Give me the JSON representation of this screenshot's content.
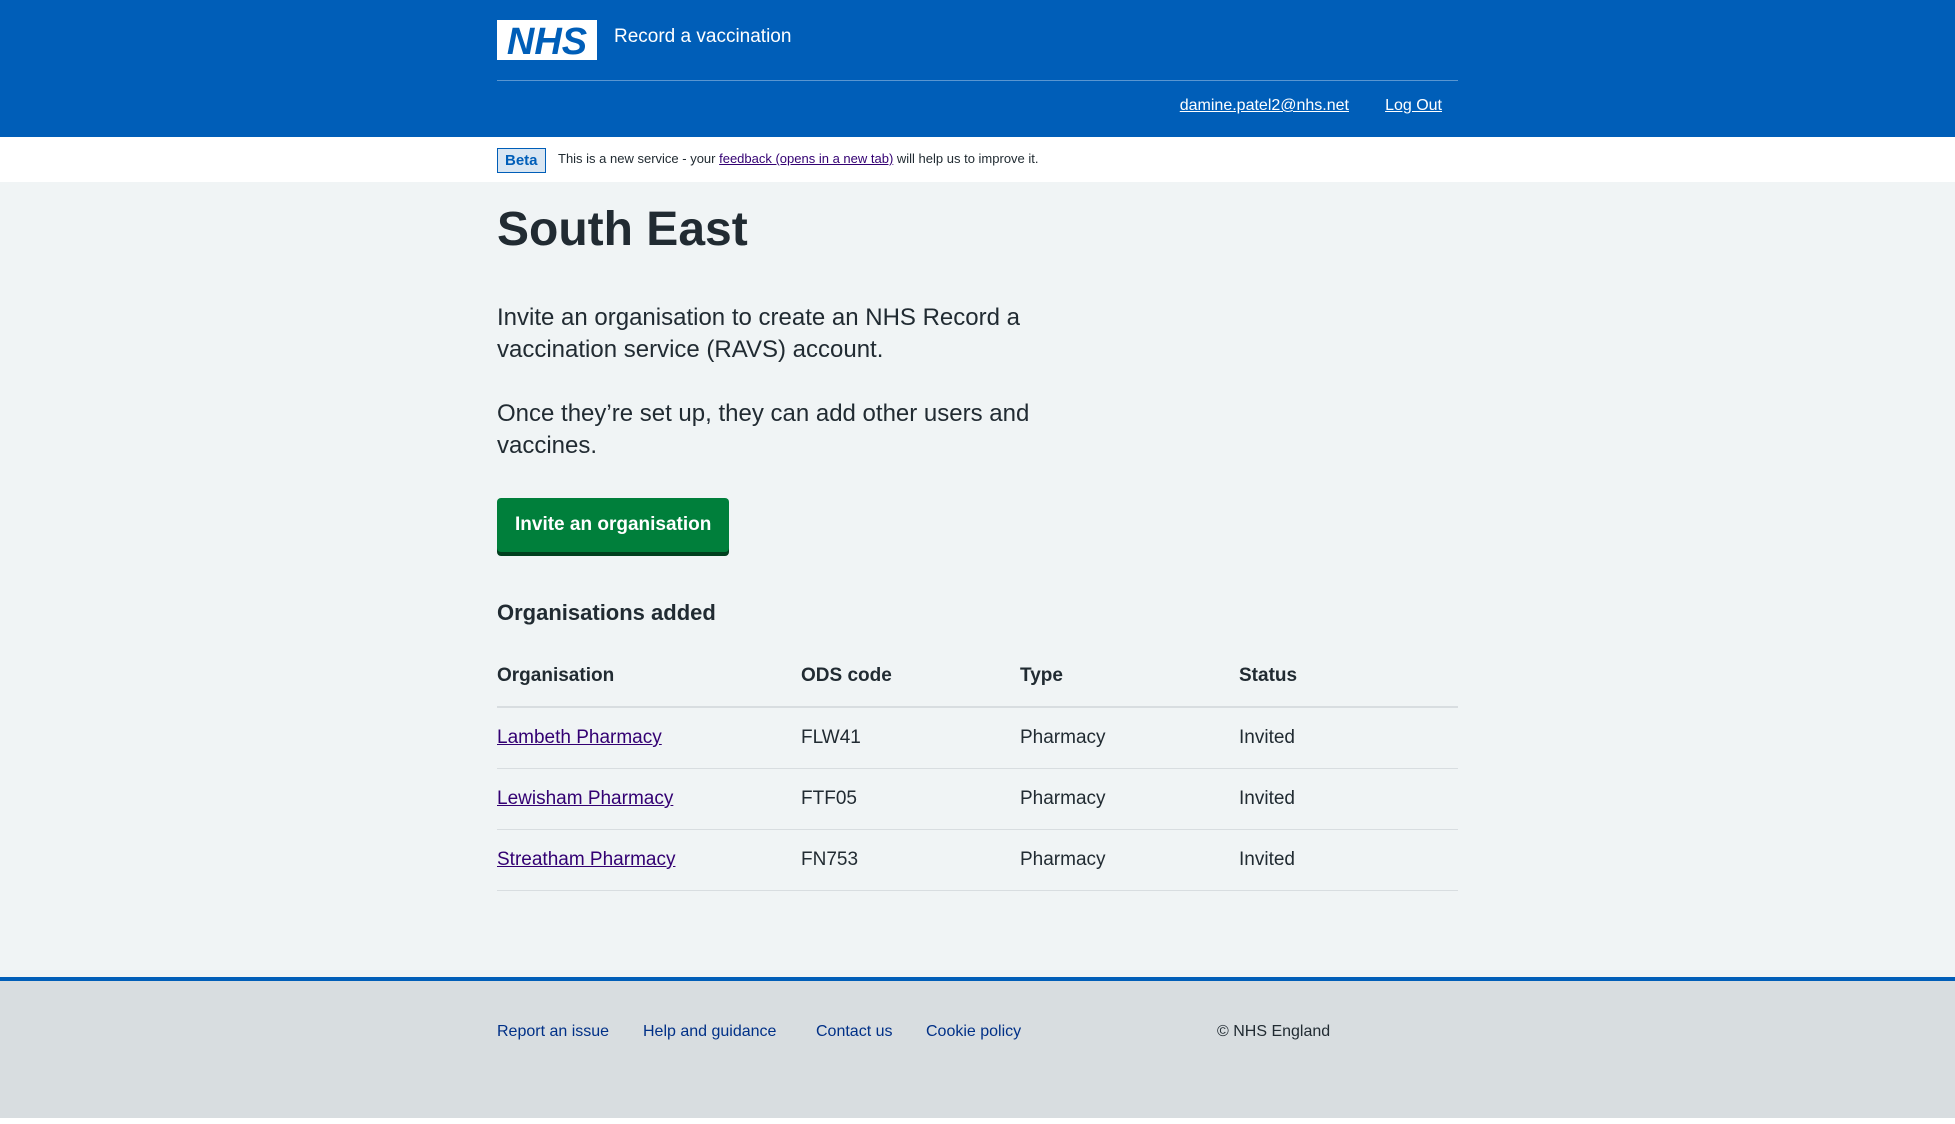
{
  "header": {
    "logo_text": "NHS",
    "service_name": "Record a vaccination",
    "user_email": "damine.patel2@nhs.net",
    "logout_label": "Log Out"
  },
  "phase_banner": {
    "tag": "Beta",
    "text_before": "This is a new service - your ",
    "link_text": "feedback (opens in a new tab)",
    "text_after": " will help us to improve it."
  },
  "main": {
    "title": "South East",
    "lede_1": "Invite an organisation to create an NHS Record a vaccination service (RAVS) account.",
    "lede_2": "Once they’re set up, they can add other users and vaccines.",
    "invite_button": "Invite an organisation",
    "organisations_heading": "Organisations added",
    "table": {
      "headers": [
        "Organisation",
        "ODS code",
        "Type",
        "Status"
      ],
      "rows": [
        {
          "organisation": "Lambeth Pharmacy",
          "ods_code": "FLW41",
          "type": "Pharmacy",
          "status": "Invited"
        },
        {
          "organisation": "Lewisham Pharmacy",
          "ods_code": "FTF05",
          "type": "Pharmacy",
          "status": "Invited"
        },
        {
          "organisation": "Streatham Pharmacy",
          "ods_code": "FN753",
          "type": "Pharmacy",
          "status": "Invited"
        }
      ]
    }
  },
  "footer": {
    "links": [
      "Report an issue",
      "Help and guidance",
      "Contact us",
      "Cookie policy"
    ],
    "copyright": "© NHS England"
  },
  "colors": {
    "header_blue": "#005eb8",
    "button_green": "#007f3b",
    "link_purple": "#330072",
    "page_background": "#f0f4f5",
    "footer_background": "#d8dde0"
  }
}
